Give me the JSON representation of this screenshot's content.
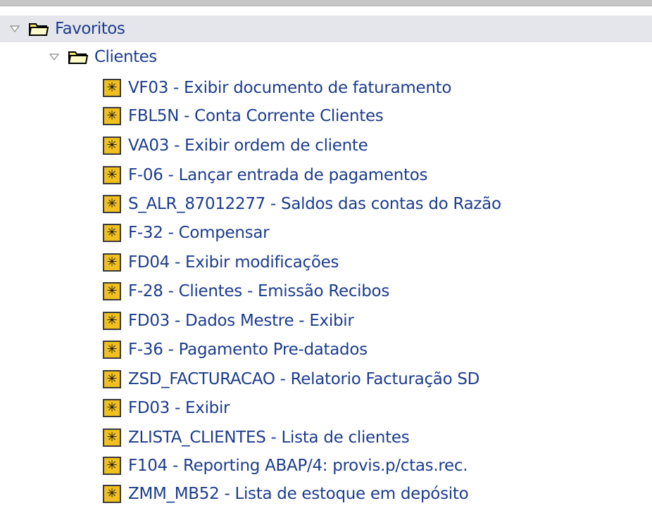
{
  "tree": {
    "root": {
      "label": "Favoritos",
      "expanded": true,
      "icon": "folder-icon",
      "folder": {
        "label": "Clientes",
        "expanded": true,
        "icon": "folder-icon",
        "items": [
          {
            "label": "VF03 - Exibir documento de faturamento"
          },
          {
            "label": "FBL5N - Conta Corrente Clientes"
          },
          {
            "label": "VA03 - Exibir ordem de cliente"
          },
          {
            "label": "F-06 - Lançar entrada de pagamentos"
          },
          {
            "label": "S_ALR_87012277 - Saldos das contas do Razão"
          },
          {
            "label": "F-32 - Compensar"
          },
          {
            "label": "FD04 - Exibir modificações"
          },
          {
            "label": "F-28 - Clientes - Emissão Recibos"
          },
          {
            "label": "FD03 - Dados Mestre - Exibir"
          },
          {
            "label": "F-36 - Pagamento Pre-datados"
          },
          {
            "label": "ZSD_FACTURACAO - Relatorio Facturação SD"
          },
          {
            "label": "FD03 - Exibir"
          },
          {
            "label": "ZLISTA_CLIENTES - Lista de clientes"
          },
          {
            "label": "F104 - Reporting ABAP/4: provis.p/ctas.rec."
          },
          {
            "label": "ZMM_MB52 - Lista de estoque em depósito"
          }
        ]
      }
    },
    "item_icon": "transaction-icon",
    "item_icon_glyph": "✳",
    "colors": {
      "text": "#1c3c8c",
      "root_row_bg": "#e5e6ec",
      "folder_fill": "#f5e96a",
      "icon_fill": "#f0c020"
    }
  }
}
